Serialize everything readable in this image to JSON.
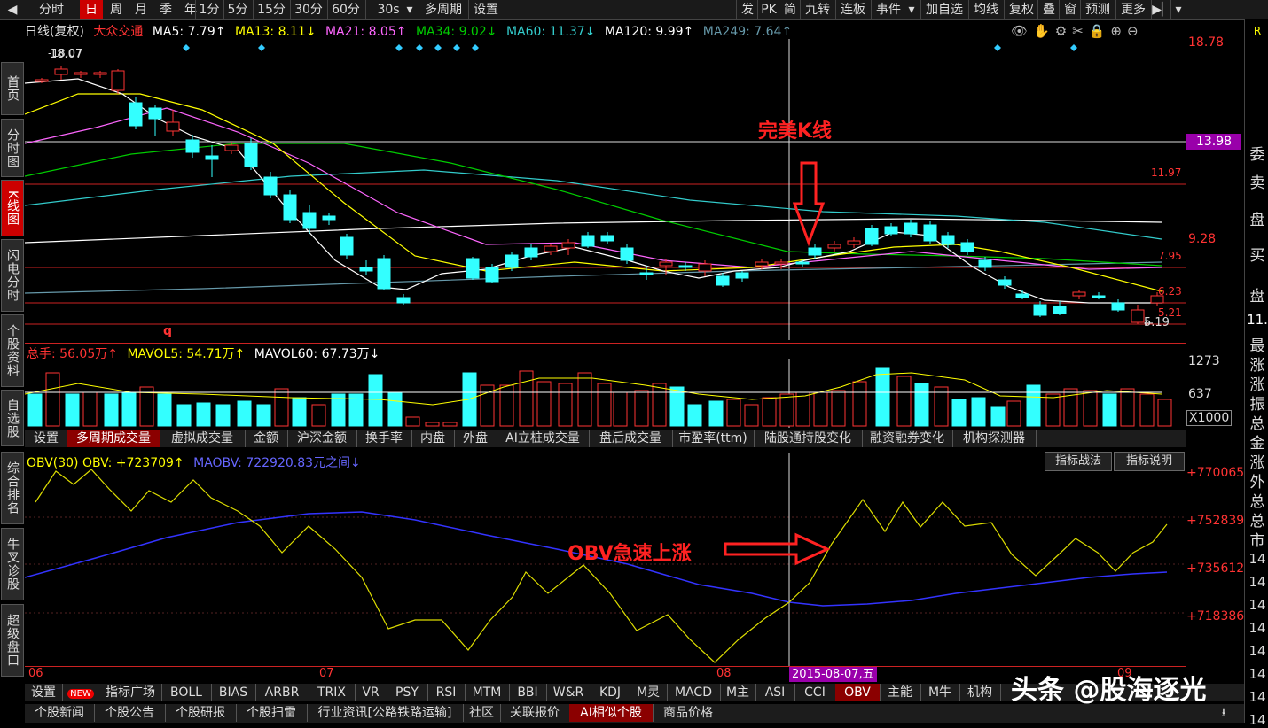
{
  "toolbar": {
    "left_items": [
      "分时",
      "日",
      "周",
      "月",
      "季",
      "年",
      "1分",
      "5分",
      "15分",
      "30分",
      "60分",
      "30s",
      "多周期",
      "设置"
    ],
    "active": "日",
    "right_items": [
      "发",
      "PK",
      "简",
      "九转",
      "连板",
      "事件",
      "加自选",
      "均线",
      "复权",
      "叠",
      "窗",
      "预测",
      "更多"
    ]
  },
  "sidebar": {
    "items": [
      "首页",
      "分时图",
      "K线图",
      "闪电分时",
      "个股资料",
      "自选股",
      "综合排名",
      "牛叉诊股",
      "超级盘口"
    ],
    "active": "K线图"
  },
  "kline": {
    "legend": {
      "title": "日线(复权)",
      "stock": "大众交通",
      "ma": [
        {
          "label": "MA5: 7.79↑",
          "color": "#ffffff"
        },
        {
          "label": "MA13: 8.11↓",
          "color": "#ffff00"
        },
        {
          "label": "MA21: 8.05↑",
          "color": "#ff66ff"
        },
        {
          "label": "MA34: 9.02↓",
          "color": "#00cc00"
        },
        {
          "label": "MA60: 11.37↓",
          "color": "#33cccc"
        },
        {
          "label": "MA120: 9.99↑",
          "color": "#ffffff"
        },
        {
          "label": "MA249: 7.64↑",
          "color": "#6699aa"
        }
      ]
    },
    "price_labels": {
      "top": "18.78",
      "p1": "13.98",
      "p2": "11.97",
      "p3": "9.28",
      "p4": "7.95",
      "p5": "6.23",
      "p6": "5.21",
      "low": "5.19",
      "high": "18.07"
    },
    "annotation": "完美K线",
    "marker_q": "q"
  },
  "volume": {
    "legend": {
      "total": "总手: 56.05万↑",
      "mavol5": "MAVOL5: 54.71万↑",
      "mavol60": "MAVOL60: 67.73万↓"
    },
    "scale": [
      "1273",
      "637",
      "X1000"
    ],
    "tabs": [
      "设置",
      "多周期成交量",
      "虚拟成交量",
      "金额",
      "沪深金额",
      "换手率",
      "内盘",
      "外盘",
      "AI立桩成交量",
      "盘后成交量",
      "市盈率(ttm)",
      "陆股通持股变化",
      "融资融券变化",
      "机构探测器"
    ],
    "active_tab": "多周期成交量"
  },
  "obv": {
    "legend": {
      "obv": "OBV(30) OBV: +723709↑",
      "maobv": "MAOBV: 722920.83元之间↓"
    },
    "buttons": [
      "指标战法",
      "指标说明"
    ],
    "scale": [
      "+770065",
      "+752839",
      "+735612",
      "+718386"
    ],
    "annotation": "OBV急速上涨",
    "date_axis": [
      "06",
      "07",
      "08",
      "09"
    ],
    "cursor_date": "2015-08-07,五"
  },
  "indicator_tabs": {
    "items": [
      "设置",
      "NEW",
      "指标广场",
      "BOLL",
      "BIAS",
      "ARBR",
      "TRIX",
      "VR",
      "PSY",
      "RSI",
      "MTM",
      "BBI",
      "W&R",
      "KDJ",
      "M灵",
      "MACD",
      "M主",
      "ASI",
      "CCI",
      "OBV",
      "主能",
      "M牛",
      "机构"
    ],
    "active": "OBV"
  },
  "bottom_tabs": {
    "items": [
      "个股新闻",
      "个股公告",
      "个股研报",
      "个股扫雷",
      "行业资讯[公路铁路运输]",
      "社区",
      "关联报价",
      "AI相似个股",
      "商品价格"
    ],
    "active": "AI相似个股"
  },
  "watermark": "头条 @股海逐光",
  "right_panel": [
    "R",
    "委",
    "卖",
    "盘",
    "买",
    "盘",
    "11.",
    "最",
    "涨",
    "涨",
    "振",
    "总",
    "金",
    "涨",
    "外",
    "总",
    "总",
    "市",
    "14",
    "14",
    "14",
    "14",
    "14",
    "14",
    "14",
    "14"
  ],
  "colors": {
    "up": "#ff3333",
    "down": "#33ffff",
    "bg": "#000000",
    "accent": "#cc0000"
  }
}
